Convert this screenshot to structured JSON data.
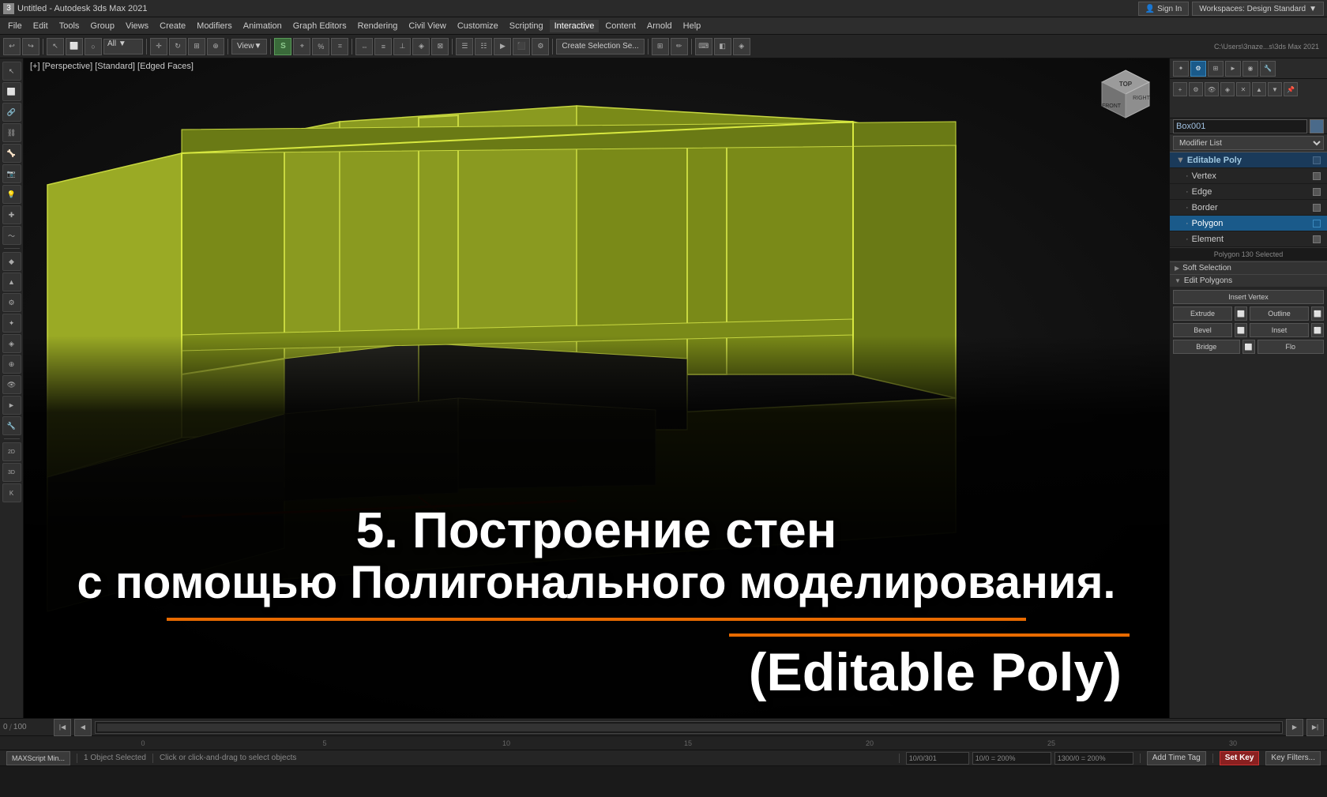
{
  "app": {
    "title": "Untitled - Autodesk 3ds Max 2021",
    "icon": "3ds-max-icon"
  },
  "titlebar": {
    "title": "Untitled - Autodesk 3ds Max 2021",
    "minimize_label": "─",
    "maximize_label": "□",
    "close_label": "✕"
  },
  "menubar": {
    "items": [
      {
        "label": "File",
        "id": "file"
      },
      {
        "label": "Edit",
        "id": "edit"
      },
      {
        "label": "Tools",
        "id": "tools"
      },
      {
        "label": "Group",
        "id": "group"
      },
      {
        "label": "Views",
        "id": "views"
      },
      {
        "label": "Create",
        "id": "create"
      },
      {
        "label": "Modifiers",
        "id": "modifiers"
      },
      {
        "label": "Animation",
        "id": "animation"
      },
      {
        "label": "Graph Editors",
        "id": "graph-editors"
      },
      {
        "label": "Rendering",
        "id": "rendering"
      },
      {
        "label": "Civil View",
        "id": "civil-view"
      },
      {
        "label": "Customize",
        "id": "customize"
      },
      {
        "label": "Scripting",
        "id": "scripting"
      },
      {
        "label": "Interactive",
        "id": "interactive"
      },
      {
        "label": "Content",
        "id": "content"
      },
      {
        "label": "Arnold",
        "id": "arnold"
      },
      {
        "label": "Help",
        "id": "help"
      }
    ]
  },
  "toolbar": {
    "select_mode": "All",
    "view_label": "View",
    "create_selection_label": "Create Selection Se...",
    "path_label": "C:\\Users\\3naze...s\\3ds Max 2021"
  },
  "viewport": {
    "label": "[+] [Perspective] [Standard] [Edged Faces]",
    "background_color": "#1a1a1a"
  },
  "overlay": {
    "line1": "5. Построение стен",
    "line2": "с помощью Полигонального моделирования.",
    "line3": "(Editable Poly)"
  },
  "right_panel": {
    "object_name": "Box001",
    "modifier_list_label": "Modifier List",
    "modifiers": [
      {
        "label": "Editable Poly",
        "id": "editable-poly",
        "type": "parent"
      },
      {
        "label": "Vertex",
        "id": "vertex",
        "type": "child"
      },
      {
        "label": "Edge",
        "id": "edge",
        "type": "child"
      },
      {
        "label": "Border",
        "id": "border",
        "type": "child"
      },
      {
        "label": "Polygon",
        "id": "polygon",
        "type": "child",
        "selected": true
      },
      {
        "label": "Element",
        "id": "element",
        "type": "child"
      }
    ],
    "selection_status": "Polygon 130 Selected",
    "soft_selection_label": "Soft Selection",
    "edit_polygons_label": "Edit Polygons",
    "buttons": {
      "insert_vertex": "Insert Vertex",
      "extrude": "Extrude",
      "outline": "Outline",
      "bevel": "Bevel",
      "inset": "Inset",
      "bridge": "Bridge",
      "flip": "Flo"
    }
  },
  "timeline": {
    "current_frame": "0",
    "total_frames": "100",
    "ticks": [
      "0",
      "5",
      "10",
      "15",
      "20",
      "25",
      "30"
    ]
  },
  "statusbar": {
    "objects_selected": "1 Object Selected",
    "instruction": "Click or click-and-drag to select objects",
    "coords": {
      "x": "10/0/301",
      "y": "10/0 = 200%",
      "z": "1300/0 = 200%"
    },
    "add_time_tag": "Add Time Tag",
    "set_key": "Set Key",
    "key_filters": "Key Filters..."
  },
  "workspace": {
    "sign_in_label": "Sign In",
    "workspaces_label": "Workspaces: Design Standard"
  },
  "sidebar_icons": [
    "pointer-icon",
    "select-icon",
    "region-icon",
    "lasso-icon",
    "paint-icon",
    "move-icon",
    "rotate-icon",
    "scale-icon",
    "pivot-icon",
    "link-icon",
    "unlink-icon",
    "bone-icon",
    "camera-icon",
    "light-icon",
    "helpers-icon",
    "spacewarp-icon",
    "set-key-icon",
    "param-icon",
    "curve-icon",
    "schematic-icon"
  ],
  "panel_tabs": [
    {
      "label": "create",
      "icon": "✦"
    },
    {
      "label": "modify",
      "icon": "⚙",
      "active": true
    },
    {
      "label": "hierarchy",
      "icon": "⊞"
    },
    {
      "label": "motion",
      "icon": "►"
    },
    {
      "label": "display",
      "icon": "◉"
    },
    {
      "label": "utilities",
      "icon": "⚒"
    }
  ]
}
